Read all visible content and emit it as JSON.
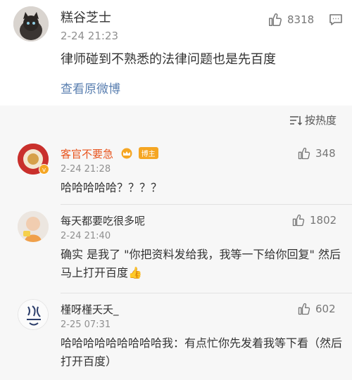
{
  "main_post": {
    "author": "糕谷芝士",
    "time": "2-24 21:23",
    "text": "律师碰到不熟悉的法律问题也是先百度",
    "view_original": "查看原微博",
    "likes": "8318"
  },
  "sort": {
    "label": "按热度"
  },
  "comments": [
    {
      "author": "客官不要急",
      "badge": "博主",
      "time": "2-24 21:28",
      "text": "哈哈哈哈哈？？？？",
      "likes": "348",
      "name_color": "#e8541e"
    },
    {
      "author": "每天都要吃很多呢",
      "time": "2-24 21:40",
      "text": "确实 是我了 \"你把资料发给我，我等一下给你回复\" 然后马上打开百度👍",
      "likes": "1802"
    },
    {
      "author": "槿呀槿夭夭_",
      "time": "2-25 07:31",
      "text": "哈哈哈哈哈哈哈哈哈我：有点忙你先发着我等下看（然后打开百度）",
      "likes": "602"
    }
  ],
  "icons": {
    "like": "thumbs-up-icon",
    "comment": "comment-icon",
    "sort": "sort-icon",
    "crown": "crown-icon",
    "verified": "verified-badge-icon"
  }
}
